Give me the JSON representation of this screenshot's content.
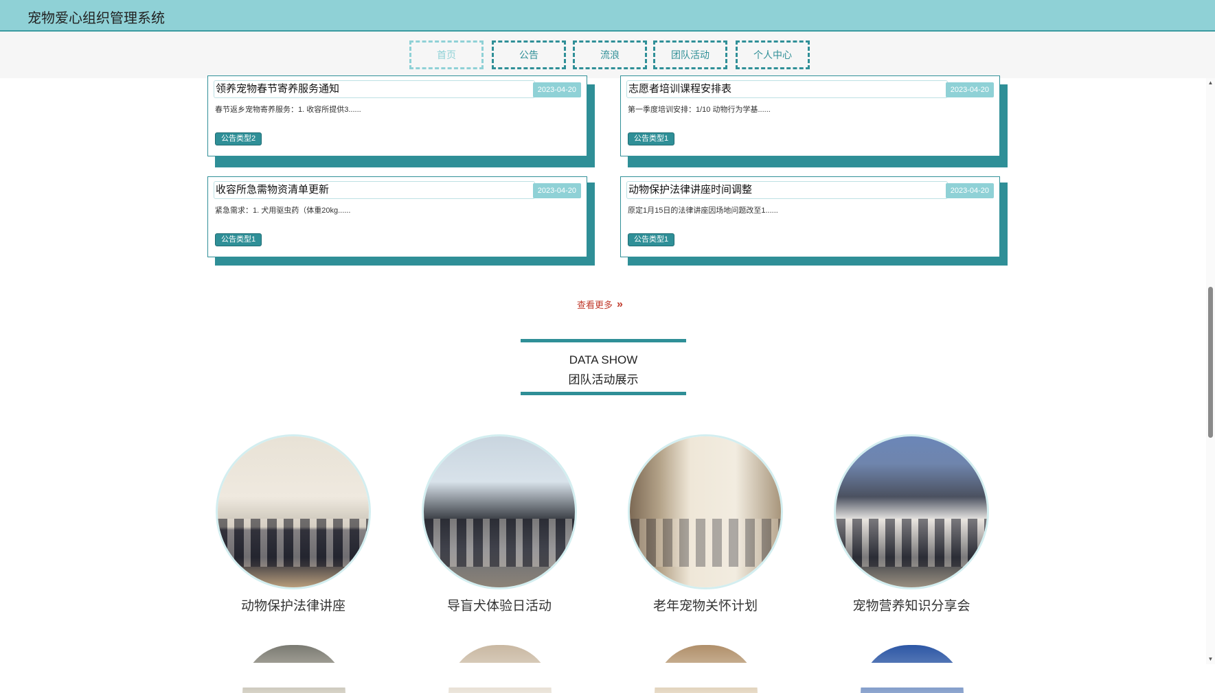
{
  "app": {
    "title": "宠物爱心组织管理系统"
  },
  "nav": {
    "items": [
      {
        "label": "首页"
      },
      {
        "label": "公告"
      },
      {
        "label": "流浪"
      },
      {
        "label": "团队活动"
      },
      {
        "label": "个人中心"
      }
    ]
  },
  "notices": [
    {
      "title": "领养宠物春节寄养服务通知",
      "date": "2023-04-20",
      "summary": "春节返乡宠物寄养服务：1. 收容所提供3......",
      "type": "公告类型2"
    },
    {
      "title": "志愿者培训课程安排表",
      "date": "2023-04-20",
      "summary": "第一季度培训安排：1/10 动物行为学基......",
      "type": "公告类型1"
    },
    {
      "title": "收容所急需物资清单更新",
      "date": "2023-04-20",
      "summary": "紧急需求：1. 犬用驱虫药（体重20kg......",
      "type": "公告类型1"
    },
    {
      "title": "动物保护法律讲座时间调整",
      "date": "2023-04-20",
      "summary": "原定1月15日的法律讲座因场地问题改至1......",
      "type": "公告类型1"
    }
  ],
  "more": {
    "label": "查看更多"
  },
  "section": {
    "title_en": "DATA SHOW",
    "title_cn": "团队活动展示"
  },
  "activities": [
    {
      "name": "动物保护法律讲座"
    },
    {
      "name": "导盲犬体验日活动"
    },
    {
      "name": "老年宠物关怀计划"
    },
    {
      "name": "宠物营养知识分享会"
    }
  ],
  "colors": {
    "header_bg": "#8fd1d6",
    "accent": "#2f8f97",
    "link": "#c0392b"
  },
  "icons": {
    "more": "double-chevron-right-icon"
  }
}
